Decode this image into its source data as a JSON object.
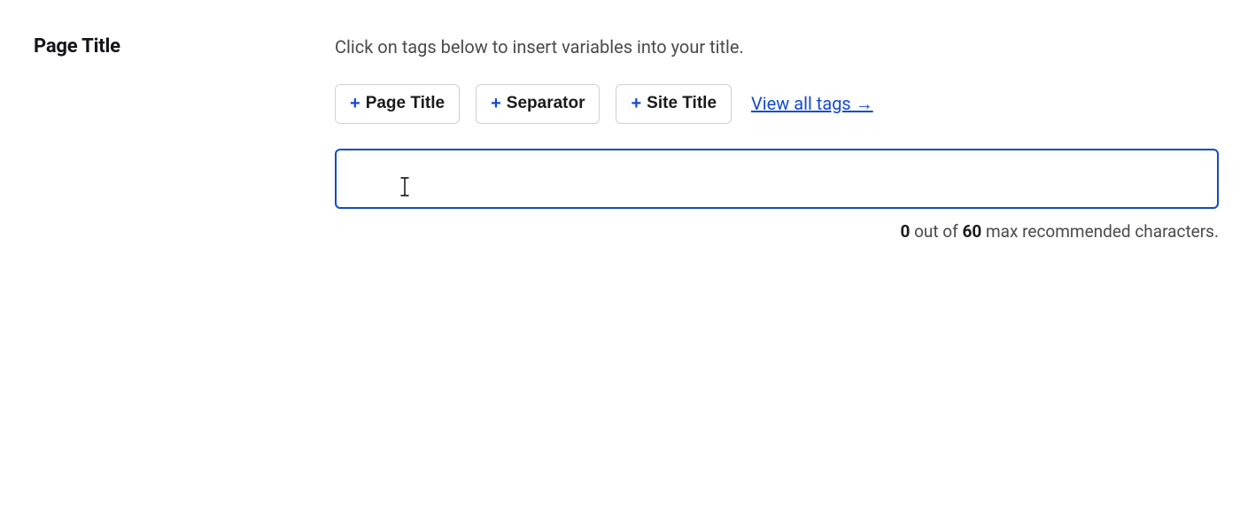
{
  "label": "Page Title",
  "helper_text": "Click on tags below to insert variables into your title.",
  "tags": {
    "page_title": "Page Title",
    "separator": "Separator",
    "site_title": "Site Title"
  },
  "view_all_link": "View all tags →",
  "input": {
    "value": "",
    "placeholder": ""
  },
  "counter": {
    "current": "0",
    "middle_text": " out of ",
    "max": "60",
    "suffix": " max recommended characters."
  }
}
